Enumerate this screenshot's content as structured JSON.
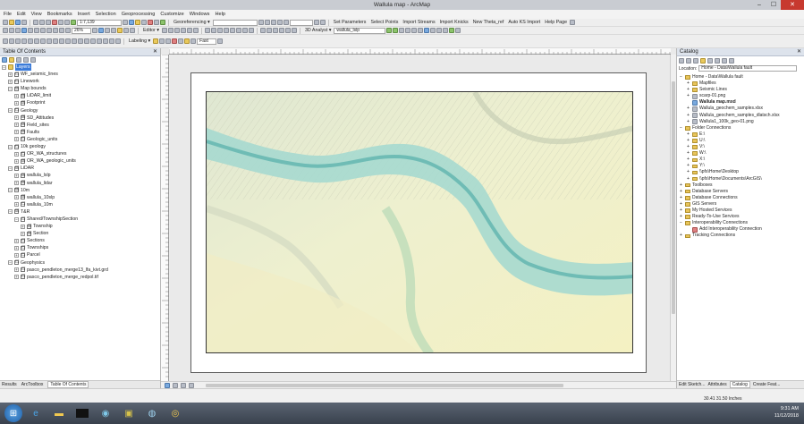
{
  "window": {
    "title": "Wallula map - ArcMap",
    "minimize": "–",
    "maximize": "☐",
    "close": "✕"
  },
  "menu": [
    "File",
    "Edit",
    "View",
    "Bookmarks",
    "Insert",
    "Selection",
    "Geoprocessing",
    "Customize",
    "Windows",
    "Help"
  ],
  "toolbar1": {
    "scale": "1:7,139",
    "georeferencing": "Georeferencing ▾",
    "set_parameters": "Set Parameters",
    "select_points": "Select Points",
    "import_streams": "Import Streams",
    "import_knicks": "Import Knicks",
    "new_theta_ref": "New Theta_ref",
    "auto_ks_import": "Auto KS Import",
    "help_page": "Help Page"
  },
  "toolbar2": {
    "zoom": "26%",
    "editor": "Editor ▾",
    "analyst_3d": "3D Analyst ▾",
    "analyst_layer": "wallula_lslp"
  },
  "toolbar3": {
    "labeling": "Labeling ▾",
    "fast": "Fast"
  },
  "toc": {
    "title": "Table Of Contents",
    "close": "✕",
    "rows": [
      {
        "indent": 0,
        "tree": "−",
        "cb": "",
        "label": "Layers",
        "selected": true
      },
      {
        "indent": 1,
        "tree": "+",
        "cb": "☐",
        "label": "WF_seismic_lines"
      },
      {
        "indent": 1,
        "tree": "+",
        "cb": "☐",
        "label": "Linework"
      },
      {
        "indent": 1,
        "tree": "−",
        "cb": "☑",
        "label": "Map bounds"
      },
      {
        "indent": 2,
        "tree": "+",
        "cb": "☑",
        "label": "LiDAR_limit"
      },
      {
        "indent": 2,
        "tree": "+",
        "cb": "☑",
        "label": "Footprint"
      },
      {
        "indent": 1,
        "tree": "−",
        "cb": "☐",
        "label": "Geology"
      },
      {
        "indent": 2,
        "tree": "+",
        "cb": "☑",
        "label": "SD_Attitudes"
      },
      {
        "indent": 2,
        "tree": "+",
        "cb": "☑",
        "label": "Field_sites"
      },
      {
        "indent": 2,
        "tree": "+",
        "cb": "☑",
        "label": "Faults"
      },
      {
        "indent": 2,
        "tree": "+",
        "cb": "☐",
        "label": "Geologic_units"
      },
      {
        "indent": 1,
        "tree": "−",
        "cb": "☐",
        "label": "10k geology"
      },
      {
        "indent": 2,
        "tree": "+",
        "cb": "☐",
        "label": "OR_WA_structures"
      },
      {
        "indent": 2,
        "tree": "+",
        "cb": "☑",
        "label": "OR_WA_geologic_units"
      },
      {
        "indent": 1,
        "tree": "−",
        "cb": "☑",
        "label": "LiDAR"
      },
      {
        "indent": 2,
        "tree": "+",
        "cb": "☑",
        "label": "wallula_lslp"
      },
      {
        "indent": 2,
        "tree": "+",
        "cb": "☑",
        "label": "wallula_lidar"
      },
      {
        "indent": 1,
        "tree": "−",
        "cb": "☑",
        "label": "10m"
      },
      {
        "indent": 2,
        "tree": "+",
        "cb": "☑",
        "label": "wallula_10slp"
      },
      {
        "indent": 2,
        "tree": "+",
        "cb": "☐",
        "label": "wallula_10m"
      },
      {
        "indent": 1,
        "tree": "−",
        "cb": "☑",
        "label": "T&R"
      },
      {
        "indent": 2,
        "tree": "−",
        "cb": "☐",
        "label": "Shared/TownshipSection"
      },
      {
        "indent": 3,
        "tree": "+",
        "cb": "☑",
        "label": "Township"
      },
      {
        "indent": 3,
        "tree": "+",
        "cb": "☑",
        "label": "Section"
      },
      {
        "indent": 2,
        "tree": "+",
        "cb": "☐",
        "label": "Sections"
      },
      {
        "indent": 2,
        "tree": "+",
        "cb": "☐",
        "label": "Townships"
      },
      {
        "indent": 2,
        "tree": "+",
        "cb": "☐",
        "label": "Parcel"
      },
      {
        "indent": 1,
        "tree": "−",
        "cb": "☐",
        "label": "Geophysics"
      },
      {
        "indent": 2,
        "tree": "+",
        "cb": "☐",
        "label": "pasco_pendleton_merge13_lfa_kivt.grd"
      },
      {
        "indent": 2,
        "tree": "+",
        "cb": "☐",
        "label": "pasco_pendleton_merge_redpol.tif"
      }
    ],
    "tabs": [
      "Results",
      "ArcToolbox",
      "Table Of Contents"
    ]
  },
  "catalog": {
    "title": "Catalog",
    "close": "✕",
    "location_label": "Location:",
    "location_value": "Home - Data\\Wallula fault",
    "rows": [
      {
        "indent": 0,
        "tree": "−",
        "icon": "folder",
        "label": "Home - Data\\Wallula fault"
      },
      {
        "indent": 1,
        "tree": "+",
        "icon": "folder",
        "label": "Mapfiles"
      },
      {
        "indent": 1,
        "tree": "+",
        "icon": "folder",
        "label": "Seismic Lines"
      },
      {
        "indent": 1,
        "tree": "+",
        "icon": "file",
        "label": "scarp-01.png"
      },
      {
        "indent": 1,
        "tree": "",
        "icon": "mxd",
        "label": "Wallula map.mxd",
        "bold": true
      },
      {
        "indent": 1,
        "tree": "+",
        "icon": "file",
        "label": "Wallula_geochem_samples.xlsx"
      },
      {
        "indent": 1,
        "tree": "+",
        "icon": "file",
        "label": "Wallula_geochem_samples_dlatsch.xlsx"
      },
      {
        "indent": 1,
        "tree": "+",
        "icon": "file",
        "label": "Wallula1_100k_geo-01.png"
      },
      {
        "indent": 0,
        "tree": "−",
        "icon": "folder",
        "label": "Folder Connections"
      },
      {
        "indent": 1,
        "tree": "+",
        "icon": "folder",
        "label": "E:\\"
      },
      {
        "indent": 1,
        "tree": "+",
        "icon": "folder",
        "label": "U:\\"
      },
      {
        "indent": 1,
        "tree": "+",
        "icon": "folder",
        "label": "V:\\"
      },
      {
        "indent": 1,
        "tree": "+",
        "icon": "folder",
        "label": "W:\\"
      },
      {
        "indent": 1,
        "tree": "+",
        "icon": "folder",
        "label": "X:\\"
      },
      {
        "indent": 1,
        "tree": "+",
        "icon": "folder",
        "label": "Y:\\"
      },
      {
        "indent": 1,
        "tree": "+",
        "icon": "folder",
        "label": "\\\\pfs\\Home\\Desktop"
      },
      {
        "indent": 1,
        "tree": "+",
        "icon": "folder",
        "label": "\\\\pfs\\Home\\Documents\\ArcGIS\\"
      },
      {
        "indent": 0,
        "tree": "+",
        "icon": "folder",
        "label": "Toolboxes"
      },
      {
        "indent": 0,
        "tree": "+",
        "icon": "folder",
        "label": "Database Servers"
      },
      {
        "indent": 0,
        "tree": "+",
        "icon": "folder",
        "label": "Database Connections"
      },
      {
        "indent": 0,
        "tree": "+",
        "icon": "folder",
        "label": "GIS Servers"
      },
      {
        "indent": 0,
        "tree": "+",
        "icon": "folder",
        "label": "My Hosted Services"
      },
      {
        "indent": 0,
        "tree": "+",
        "icon": "folder",
        "label": "Ready-To-Use Services"
      },
      {
        "indent": 0,
        "tree": "−",
        "icon": "folder",
        "label": "Interoperability Connections"
      },
      {
        "indent": 1,
        "tree": "",
        "icon": "tool",
        "label": "Add Interoperability Connection"
      },
      {
        "indent": 0,
        "tree": "+",
        "icon": "folder",
        "label": "Tracking Connections"
      }
    ],
    "tabs": [
      "Edit Sketch...",
      "Attributes",
      "Catalog",
      "Create Feat..."
    ]
  },
  "status": {
    "coords": "30.41  31.50 Inches"
  },
  "taskbar": {
    "time": "9:31 AM",
    "date": "11/12/2018"
  }
}
